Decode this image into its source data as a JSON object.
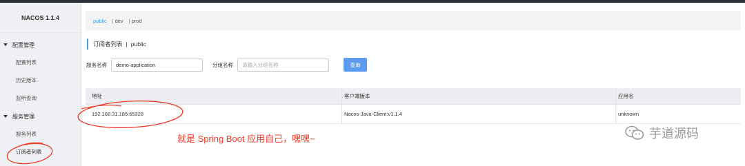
{
  "app": {
    "title": "NACOS 1.1.4"
  },
  "sidebar": {
    "groups": [
      {
        "label": "配置管理",
        "items": [
          {
            "label": "配置列表"
          },
          {
            "label": "历史版本"
          },
          {
            "label": "监听查询"
          }
        ]
      },
      {
        "label": "服务管理",
        "items": [
          {
            "label": "服务列表"
          },
          {
            "label": "订阅者列表"
          }
        ]
      }
    ]
  },
  "namespaces": {
    "items": [
      "public",
      "dev",
      "prod"
    ],
    "active": "public",
    "separator": "|"
  },
  "page": {
    "title": "订阅者列表",
    "separator": "|",
    "namespace": "public"
  },
  "form": {
    "service_label": "服务名称",
    "service_value": "demo-application",
    "group_label": "分组名称",
    "group_placeholder": "请输入分组名称",
    "query_button": "查询"
  },
  "table": {
    "headers": [
      "地址",
      "客户端版本",
      "应用名"
    ],
    "rows": [
      {
        "address": "192.168.31.185:65328",
        "client_version": "Nacos-Java-Client:v1.1.4",
        "app_name": "unknown"
      }
    ]
  },
  "annotation": {
    "text": "就是 Spring Boot 应用自己，嘿嘿~",
    "color": "#ee3b2b"
  },
  "watermark": {
    "text": "芋道源码",
    "icon": "wechat-icon"
  },
  "colors": {
    "accent": "#3e9cec",
    "button": "#5b9cf0",
    "annotation": "#ee3b2b"
  }
}
